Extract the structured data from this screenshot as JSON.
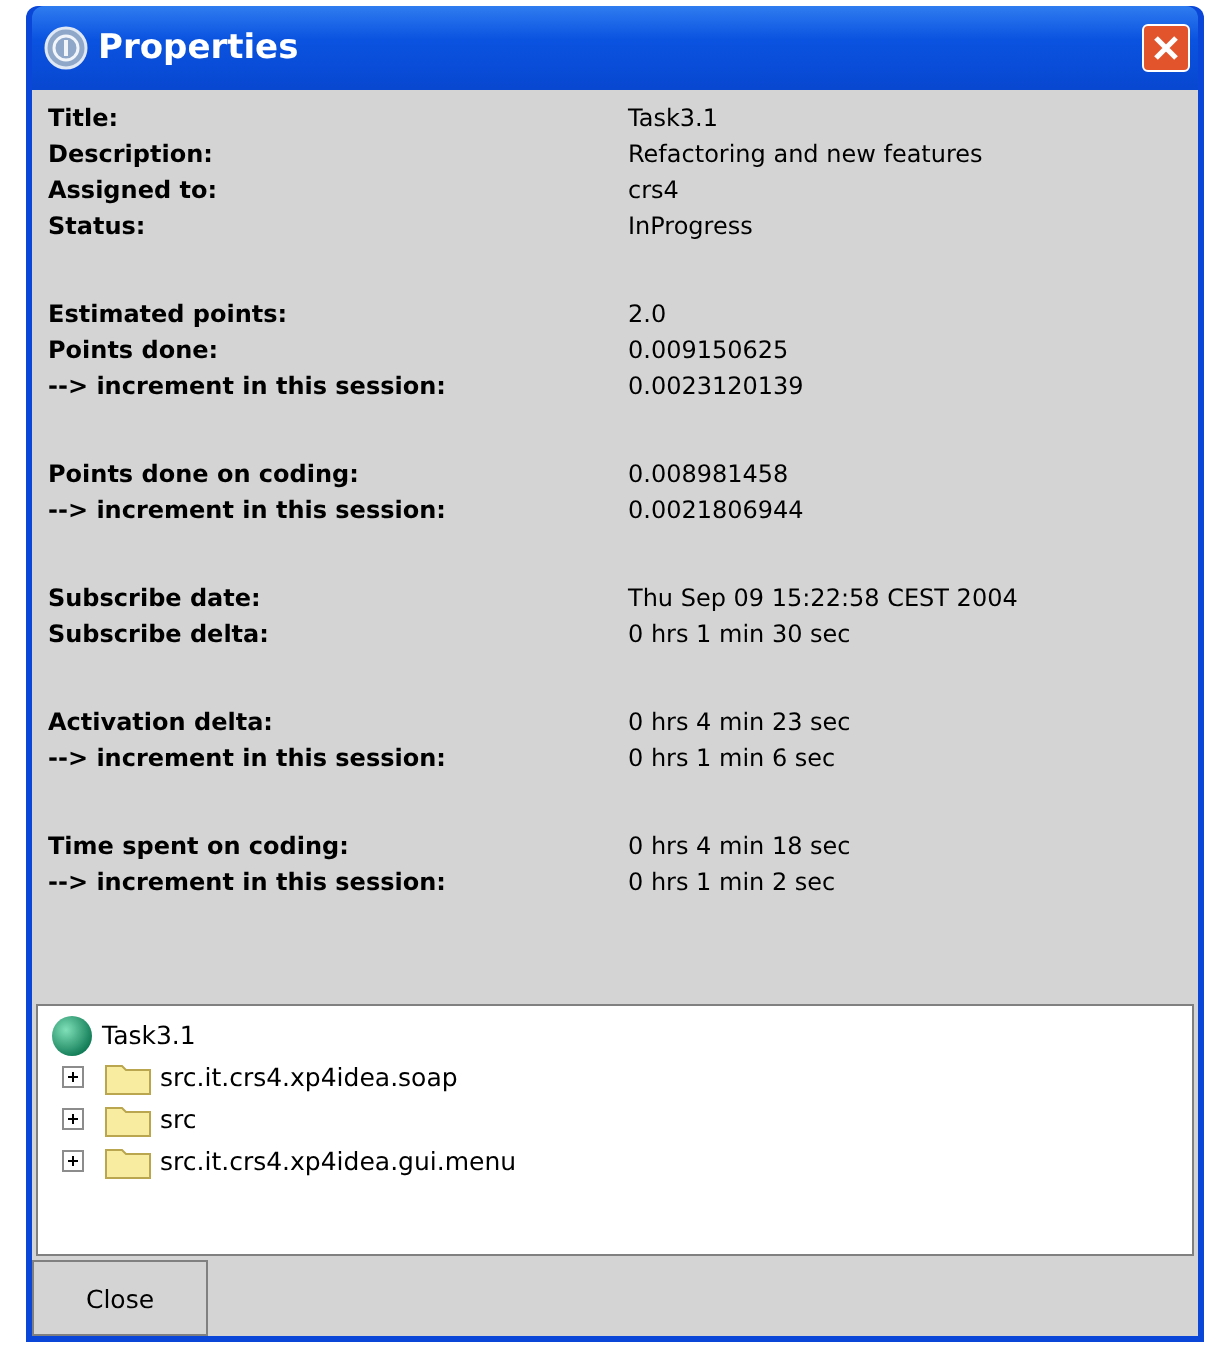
{
  "window": {
    "title": "Properties"
  },
  "groups": [
    {
      "rows": [
        {
          "label": "Title:",
          "value": "Task3.1"
        },
        {
          "label": "Description:",
          "value": "Refactoring and new features"
        },
        {
          "label": "Assigned to:",
          "value": "crs4"
        },
        {
          "label": "Status:",
          "value": "InProgress"
        }
      ]
    },
    {
      "rows": [
        {
          "label": "Estimated points:",
          "value": "2.0"
        },
        {
          "label": "Points done:",
          "value": "0.009150625"
        },
        {
          "label": "--> increment in this session:",
          "value": "0.0023120139"
        }
      ]
    },
    {
      "rows": [
        {
          "label": "Points done on coding:",
          "value": "0.008981458"
        },
        {
          "label": "--> increment in this session:",
          "value": "0.0021806944"
        }
      ]
    },
    {
      "rows": [
        {
          "label": "Subscribe date:",
          "value": "Thu Sep 09 15:22:58 CEST 2004"
        },
        {
          "label": "Subscribe delta:",
          "value": "0 hrs 1 min 30 sec"
        }
      ]
    },
    {
      "rows": [
        {
          "label": "Activation delta:",
          "value": "0 hrs 4 min 23 sec"
        },
        {
          "label": "--> increment in this session:",
          "value": "0 hrs 1 min 6 sec"
        }
      ]
    },
    {
      "rows": [
        {
          "label": "Time spent on coding:",
          "value": "0 hrs 4 min 18 sec"
        },
        {
          "label": "--> increment in this session:",
          "value": "0 hrs 1 min 2 sec"
        }
      ]
    }
  ],
  "tree": {
    "root": "Task3.1",
    "children": [
      {
        "label": "src.it.crs4.xp4idea.soap",
        "expanded": false
      },
      {
        "label": "src",
        "expanded": false
      },
      {
        "label": "src.it.crs4.xp4idea.gui.menu",
        "expanded": false
      }
    ]
  },
  "buttons": [
    "Close"
  ]
}
